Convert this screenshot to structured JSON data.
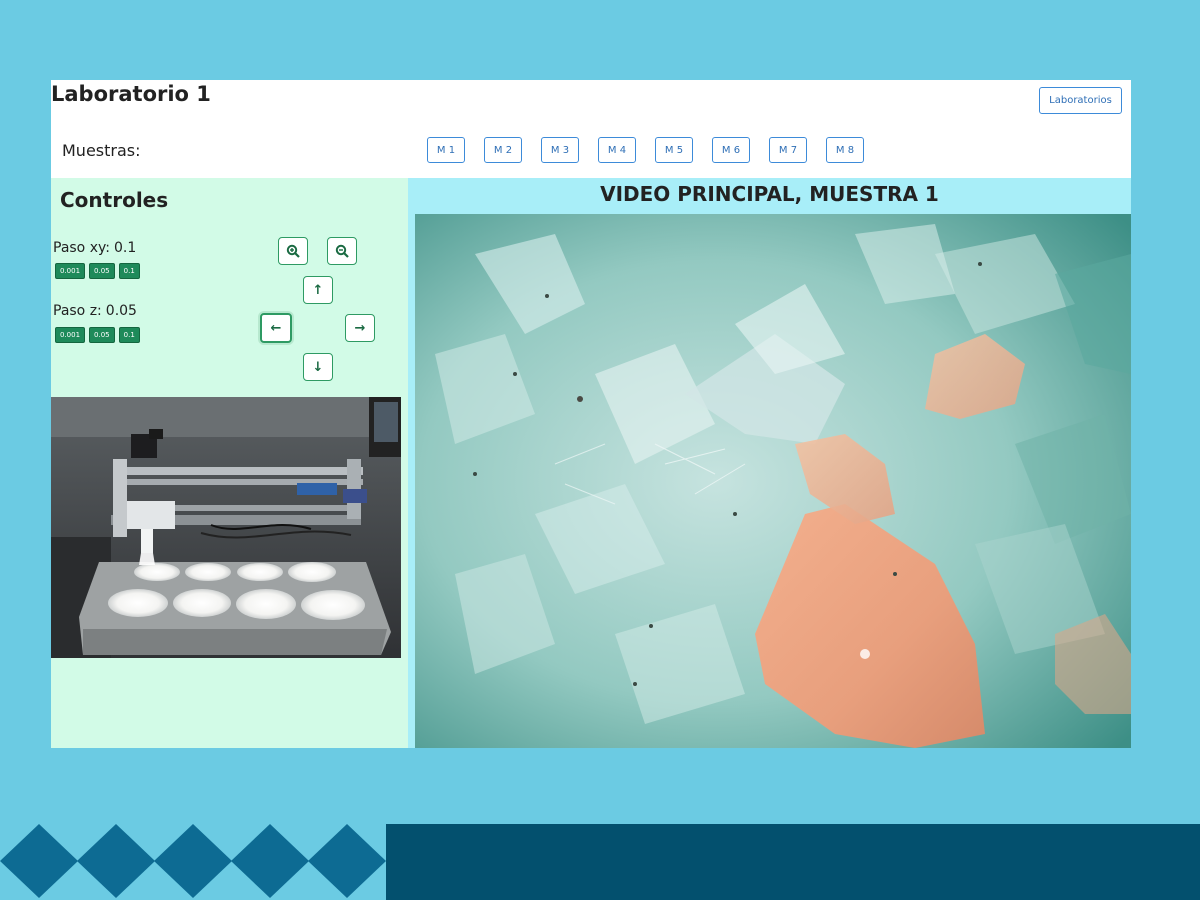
{
  "header": {
    "title": "Laboratorio 1",
    "labs_button": "Laboratorios",
    "samples_label": "Muestras:",
    "samples": [
      "M 1",
      "M 2",
      "M 3",
      "M 4",
      "M 5",
      "M 6",
      "M 7",
      "M 8"
    ]
  },
  "controls": {
    "title": "Controles",
    "xy": {
      "label": "Paso xy:",
      "value": "0.1",
      "options": [
        "0.001",
        "0.05",
        "0.1"
      ]
    },
    "z": {
      "label": "Paso z:",
      "value": "0.05",
      "options": [
        "0.001",
        "0.05",
        "0.1"
      ]
    },
    "icons": {
      "zoom_in": "zoom-in-icon",
      "zoom_out": "zoom-out-icon",
      "up": "arrow-up-icon",
      "down": "arrow-down-icon",
      "left": "arrow-left-icon",
      "right": "arrow-right-icon"
    },
    "selected_direction": "left"
  },
  "video": {
    "title": "VIDEO PRINCIPAL, MUESTRA 1"
  },
  "colors": {
    "page_background": "#6bcbe3",
    "controls_background": "#d2fbe7",
    "video_header_background": "#a8eef8",
    "accent_button": "#1e8a5a",
    "outline_button": "#3d8bd9",
    "deco_dark": "#03506e",
    "deco_diamond": "#0d6b93"
  }
}
